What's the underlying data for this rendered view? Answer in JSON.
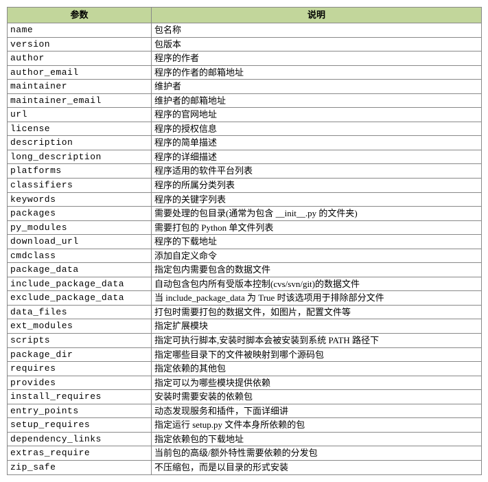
{
  "headers": {
    "param": "参数",
    "desc": "说明"
  },
  "rows": [
    {
      "param": "name",
      "desc": "包名称"
    },
    {
      "param": "version",
      "desc": "包版本"
    },
    {
      "param": "author",
      "desc": "程序的作者"
    },
    {
      "param": "author_email",
      "desc": "程序的作者的邮箱地址"
    },
    {
      "param": "maintainer",
      "desc": "维护者"
    },
    {
      "param": "maintainer_email",
      "desc": "维护者的邮箱地址"
    },
    {
      "param": "url",
      "desc": "程序的官网地址"
    },
    {
      "param": "license",
      "desc": "程序的授权信息"
    },
    {
      "param": "description",
      "desc": "程序的简单描述"
    },
    {
      "param": "long_description",
      "desc": "程序的详细描述"
    },
    {
      "param": "platforms",
      "desc": "程序适用的软件平台列表"
    },
    {
      "param": "classifiers",
      "desc": "程序的所属分类列表"
    },
    {
      "param": "keywords",
      "desc": "程序的关键字列表"
    },
    {
      "param": "packages",
      "desc": "需要处理的包目录(通常为包含 __init__.py 的文件夹)"
    },
    {
      "param": "py_modules",
      "desc": "需要打包的 Python 单文件列表"
    },
    {
      "param": "download_url",
      "desc": "程序的下载地址"
    },
    {
      "param": "cmdclass",
      "desc": "添加自定义命令"
    },
    {
      "param": "package_data",
      "desc": "指定包内需要包含的数据文件"
    },
    {
      "param": "include_package_data",
      "desc": "自动包含包内所有受版本控制(cvs/svn/git)的数据文件"
    },
    {
      "param": "exclude_package_data",
      "desc": "当 include_package_data 为 True 时该选项用于排除部分文件"
    },
    {
      "param": "data_files",
      "desc": "打包时需要打包的数据文件，如图片，配置文件等"
    },
    {
      "param": "ext_modules",
      "desc": "指定扩展模块"
    },
    {
      "param": "scripts",
      "desc": "指定可执行脚本,安装时脚本会被安装到系统 PATH 路径下"
    },
    {
      "param": "package_dir",
      "desc": "指定哪些目录下的文件被映射到哪个源码包"
    },
    {
      "param": "requires",
      "desc": "指定依赖的其他包"
    },
    {
      "param": "provides",
      "desc": "指定可以为哪些模块提供依赖"
    },
    {
      "param": "install_requires",
      "desc": "安装时需要安装的依赖包"
    },
    {
      "param": "entry_points",
      "desc": "动态发现服务和插件，下面详细讲"
    },
    {
      "param": "setup_requires",
      "desc": "指定运行 setup.py 文件本身所依赖的包"
    },
    {
      "param": "dependency_links",
      "desc": "指定依赖包的下载地址"
    },
    {
      "param": "extras_require",
      "desc": "当前包的高级/额外特性需要依赖的分发包"
    },
    {
      "param": "zip_safe",
      "desc": "不压缩包，而是以目录的形式安装"
    }
  ]
}
